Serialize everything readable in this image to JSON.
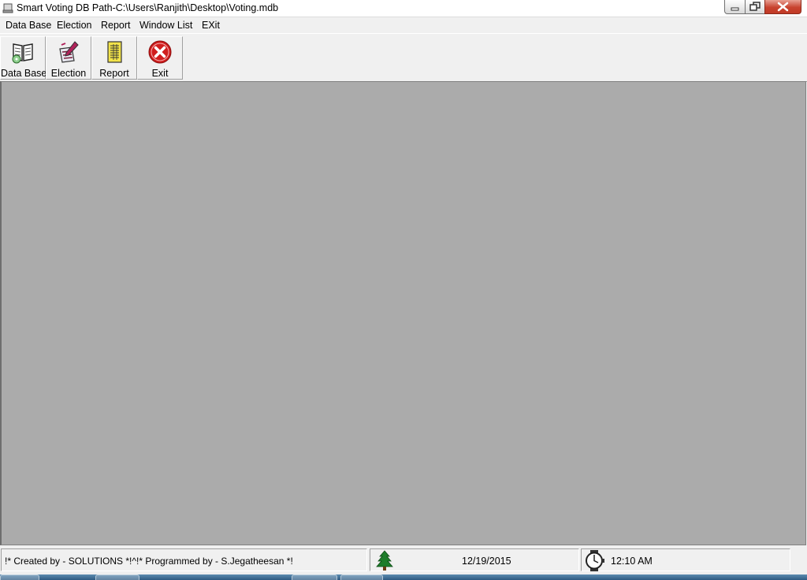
{
  "window": {
    "title": "Smart Voting  DB Path-C:\\Users\\Ranjith\\Desktop\\Voting.mdb"
  },
  "menu": [
    {
      "label": "Data Base"
    },
    {
      "label": "Election"
    },
    {
      "label": "Report"
    },
    {
      "label": "Window List"
    },
    {
      "label": "EXit"
    }
  ],
  "toolbar": [
    {
      "label": "Data Base",
      "icon": "book-database-icon"
    },
    {
      "label": "Election",
      "icon": "election-pen-icon"
    },
    {
      "label": "Report",
      "icon": "report-sheet-icon"
    },
    {
      "label": "Exit",
      "icon": "exit-x-icon"
    }
  ],
  "status": {
    "credits": "!* Created by - SOLUTIONS *!^!* Programmed by - S.Jegatheesan *!",
    "date": "12/19/2015",
    "time": "12:10 AM"
  },
  "colors": {
    "mdi_background": "#ababab",
    "exit_red": "#d01e1e",
    "tree_green": "#1e7d2a"
  }
}
